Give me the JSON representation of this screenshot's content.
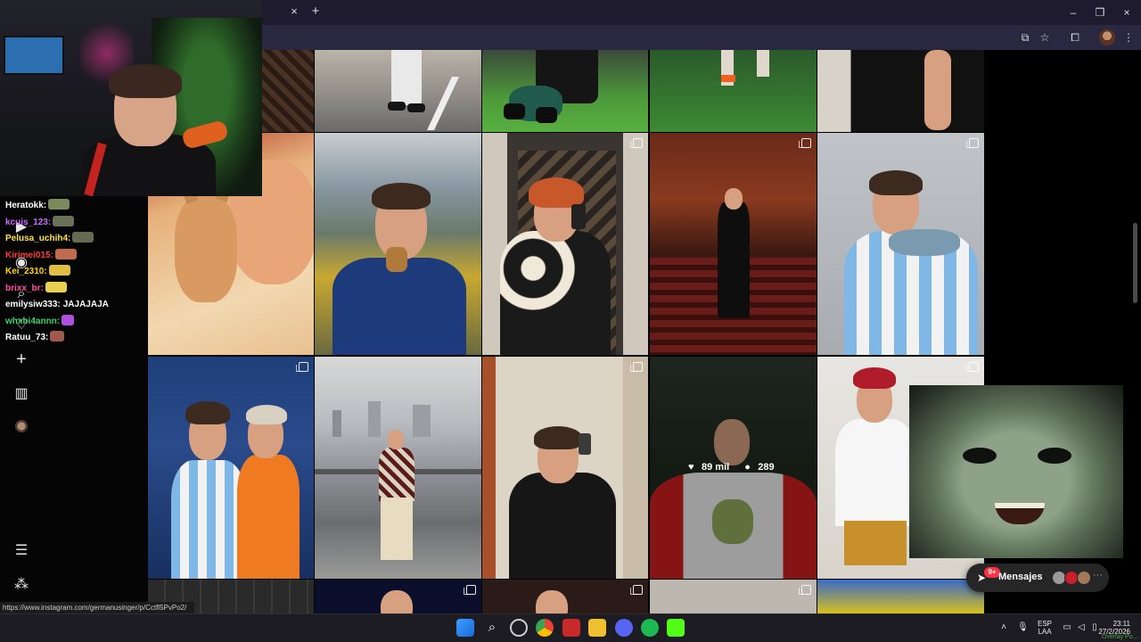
{
  "browser": {
    "tab_close_glyph": "×",
    "new_tab_glyph": "+",
    "window_controls": [
      "–",
      "❐",
      "×"
    ]
  },
  "chat": [
    {
      "user": "Heratokk:",
      "color": "#ffffff",
      "emote_color": "#7a8a5a",
      "msg": ""
    },
    {
      "user": "kcuis_123:",
      "color": "#c86cff",
      "emote_color": "#6a7058",
      "msg": ""
    },
    {
      "user": "Pelusa_uchih4:",
      "color": "#ffe14a",
      "emote_color": "#666a50",
      "msg": ""
    },
    {
      "user": "Kirimei015:",
      "color": "#ff3b3b",
      "emote_color": "#c06a50",
      "msg": ""
    },
    {
      "user": "Kei_2310:",
      "color": "#ffd400",
      "emote_color": "#e0c040",
      "msg": ""
    },
    {
      "user": "brixx_br:",
      "color": "#ff4fa0",
      "emote_color": "#e8d050",
      "msg": ""
    },
    {
      "user": "emilysiw333:",
      "color": "#ffffff",
      "emote_color": "",
      "msg": "JAJAJAJA"
    },
    {
      "user": "whxbi4annn:",
      "color": "#3ad06a",
      "emote_color": "#b050e0",
      "msg": ""
    },
    {
      "user": "Ratuu_73:",
      "color": "#ffffff",
      "emote_color": "#a05a50",
      "msg": ""
    }
  ],
  "sidebar": {
    "plus_glyph": "+",
    "menu_glyph": "☰"
  },
  "post_hover": {
    "likes": "89 mil",
    "comments": "289"
  },
  "messages": {
    "label": "Mensajes",
    "badge": "9+"
  },
  "status_url": "https://www.instagram.com/germanusinger/p/Cctfl5PvPo2/",
  "taskbar": {
    "lang_top": "ESP",
    "lang_bottom": "LAA",
    "time": "23:11",
    "date": "27/2/2026",
    "overlay_tag": "Overlay Po..."
  },
  "colors": {
    "instagram_bg": "#000000",
    "badge_red": "#ff3040",
    "browser_tabbar": "#1f1b2e"
  }
}
